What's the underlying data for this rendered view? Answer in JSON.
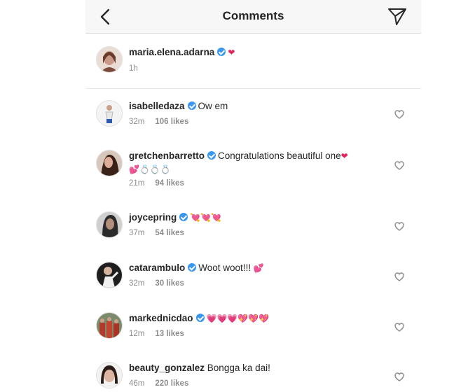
{
  "header": {
    "title": "Comments"
  },
  "caption": {
    "username": "maria.elena.adarna",
    "text": "❤",
    "time": "1h"
  },
  "comments": [
    {
      "username": "isabelledaza",
      "text": "Ow em",
      "time": "32m",
      "likes": "106 likes"
    },
    {
      "username": "gretchenbarretto",
      "text": "Congratulations beautiful one",
      "emoji_end": "❤",
      "emoji_line2": "💕💍💍💍",
      "time": "21m",
      "likes": "94 likes"
    },
    {
      "username": "joycepring",
      "text": "",
      "emoji": "💘💘💘",
      "time": "37m",
      "likes": "54 likes"
    },
    {
      "username": "catarambulo",
      "text": "Woot woot!!!",
      "emoji": "💕",
      "time": "32m",
      "likes": "30 likes"
    },
    {
      "username": "markednicdao",
      "text": "",
      "emoji": "💗💗💗💖💖💖",
      "time": "12m",
      "likes": "13 likes"
    },
    {
      "username": "beauty_gonzalez",
      "text": "Bongga ka dai!",
      "time": "46m",
      "likes": "220 likes"
    }
  ],
  "colors": {
    "verified": "#3897f0",
    "meta": "#8e8e8e",
    "header_bg": "#f7f7f7"
  },
  "icons": {
    "back": "chevron-left-icon",
    "send": "paper-plane-icon",
    "like": "heart-outline-icon"
  }
}
